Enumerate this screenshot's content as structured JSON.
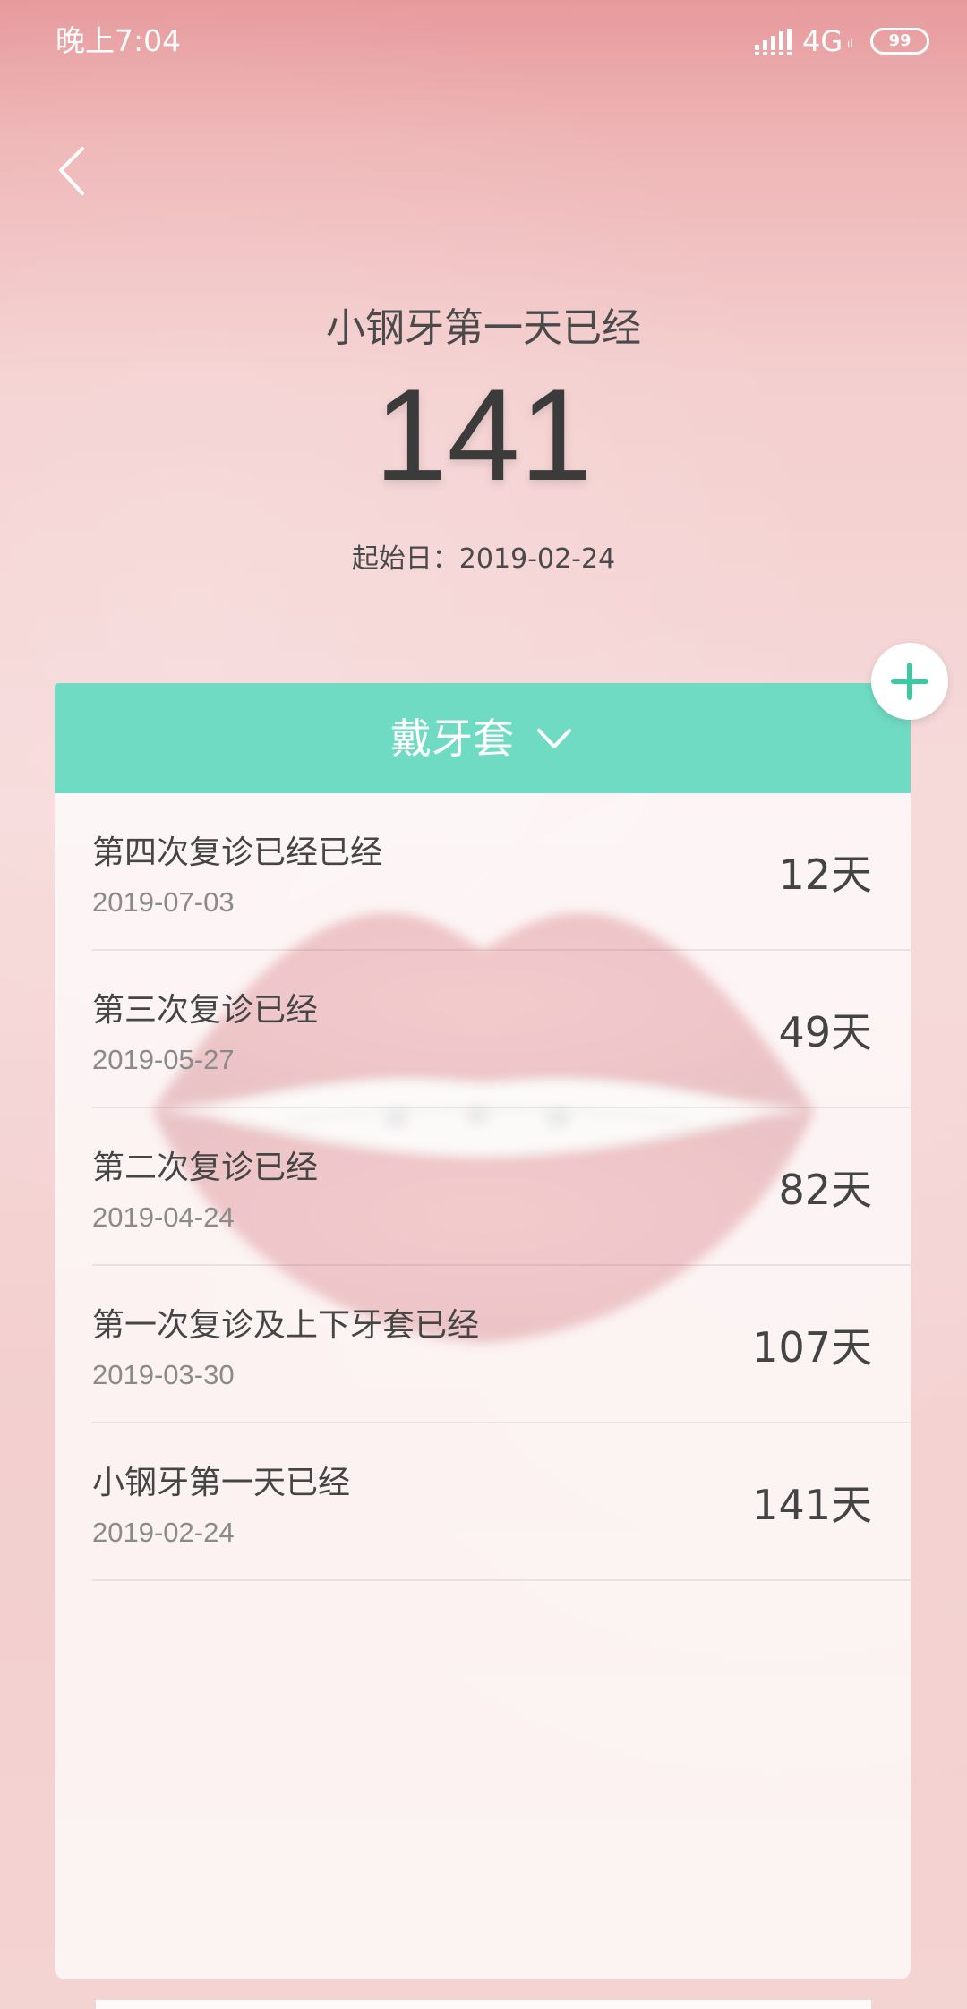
{
  "status_bar": {
    "time": "晚上7:04",
    "network": "4G",
    "network_sub": "ıl",
    "battery": "99"
  },
  "header": {
    "title": "小钢牙第一天已经",
    "days": "141",
    "start_date": "起始日：2019-02-24"
  },
  "card": {
    "title": "戴牙套"
  },
  "events": [
    {
      "title": "第四次复诊已经已经",
      "date": "2019-07-03",
      "days": "12天"
    },
    {
      "title": "第三次复诊已经",
      "date": "2019-05-27",
      "days": "49天"
    },
    {
      "title": "第二次复诊已经",
      "date": "2019-04-24",
      "days": "82天"
    },
    {
      "title": "第一次复诊及上下牙套已经",
      "date": "2019-03-30",
      "days": "107天"
    },
    {
      "title": "小钢牙第一天已经",
      "date": "2019-02-24",
      "days": "141天"
    }
  ],
  "icons": {
    "back": "chevron-left-icon",
    "signal": "signal-icon",
    "battery": "battery-icon",
    "dropdown": "chevron-down-icon",
    "add": "plus-icon"
  },
  "colors": {
    "accent": "#70dbc3",
    "plus": "#3fc9a2",
    "background_top": "#e79a9c",
    "background_bottom": "#f4d3d3"
  }
}
